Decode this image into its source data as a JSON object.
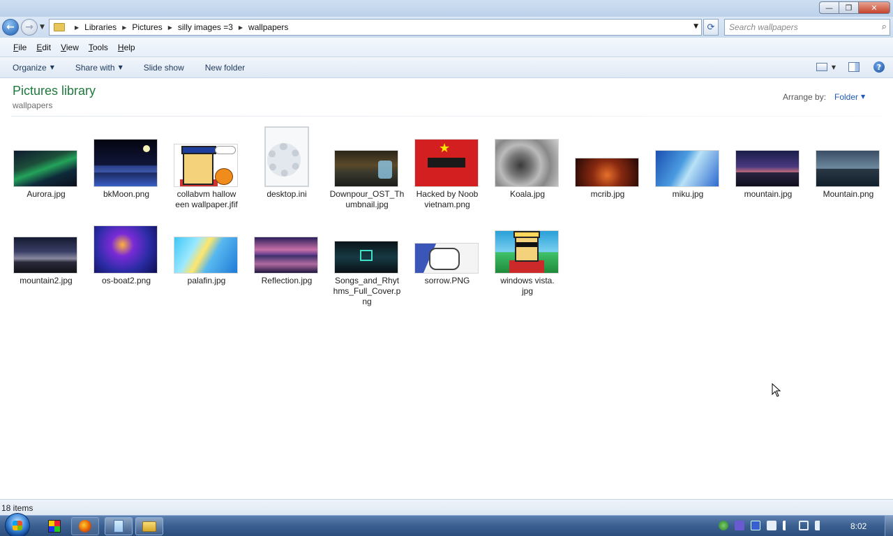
{
  "window": {
    "controls": {
      "minimize": "—",
      "maximize": "❐",
      "close": "✕"
    }
  },
  "nav": {
    "back_glyph": "←",
    "forward_glyph": "→",
    "breadcrumb": [
      "Libraries",
      "Pictures",
      "silly images =3",
      "wallpapers"
    ],
    "refresh_glyph": "⟳",
    "search_placeholder": "Search wallpapers"
  },
  "menu": {
    "items": [
      {
        "hot": "F",
        "rest": "ile"
      },
      {
        "hot": "E",
        "rest": "dit"
      },
      {
        "hot": "V",
        "rest": "iew"
      },
      {
        "hot": "T",
        "rest": "ools"
      },
      {
        "hot": "H",
        "rest": "elp"
      }
    ]
  },
  "toolbar": {
    "organize": "Organize",
    "share_with": "Share with",
    "slide_show": "Slide show",
    "new_folder": "New folder",
    "help_glyph": "?"
  },
  "library": {
    "title": "Pictures library",
    "subtitle": "wallpapers",
    "arrange_label": "Arrange by:",
    "arrange_value": "Folder"
  },
  "files": [
    {
      "name": "Aurora.jpg",
      "type": "image"
    },
    {
      "name": "bkMoon.png",
      "type": "image"
    },
    {
      "name": "collabvm halloween wallpaper.jfif",
      "type": "image"
    },
    {
      "name": "desktop.ini",
      "type": "settings"
    },
    {
      "name": "Downpour_OST_Thumbnail.jpg",
      "type": "image"
    },
    {
      "name": "Hacked by Noob vietnam.png",
      "type": "image"
    },
    {
      "name": "Koala.jpg",
      "type": "image"
    },
    {
      "name": "mcrib.jpg",
      "type": "image"
    },
    {
      "name": "miku.jpg",
      "type": "image"
    },
    {
      "name": "mountain.jpg",
      "type": "image"
    },
    {
      "name": "Mountain.png",
      "type": "image"
    },
    {
      "name": "mountain2.jpg",
      "type": "image"
    },
    {
      "name": "os-boat2.png",
      "type": "image"
    },
    {
      "name": "palafin.jpg",
      "type": "image"
    },
    {
      "name": "Reflection.jpg",
      "type": "image"
    },
    {
      "name": "Songs_and_Rhythms_Full_Cover.png",
      "type": "image"
    },
    {
      "name": "sorrow.PNG",
      "type": "image"
    },
    {
      "name": "windows vista.jpg",
      "type": "image"
    }
  ],
  "status": {
    "item_count": "18 items"
  },
  "taskbar": {
    "clock": "8:02",
    "apps": [
      "paint-app-icon",
      "firefox-icon",
      "notepad-icon",
      "explorer-icon"
    ],
    "tray_icons": [
      "network-icon",
      "microphone-icon",
      "display-icon",
      "usb-icon",
      "action-center-flag-icon",
      "network-connection-icon",
      "volume-icon"
    ]
  },
  "colors": {
    "library_title": "#1e7a3c",
    "link_blue": "#1e5bb3",
    "taskbar": "#3a5f90"
  }
}
